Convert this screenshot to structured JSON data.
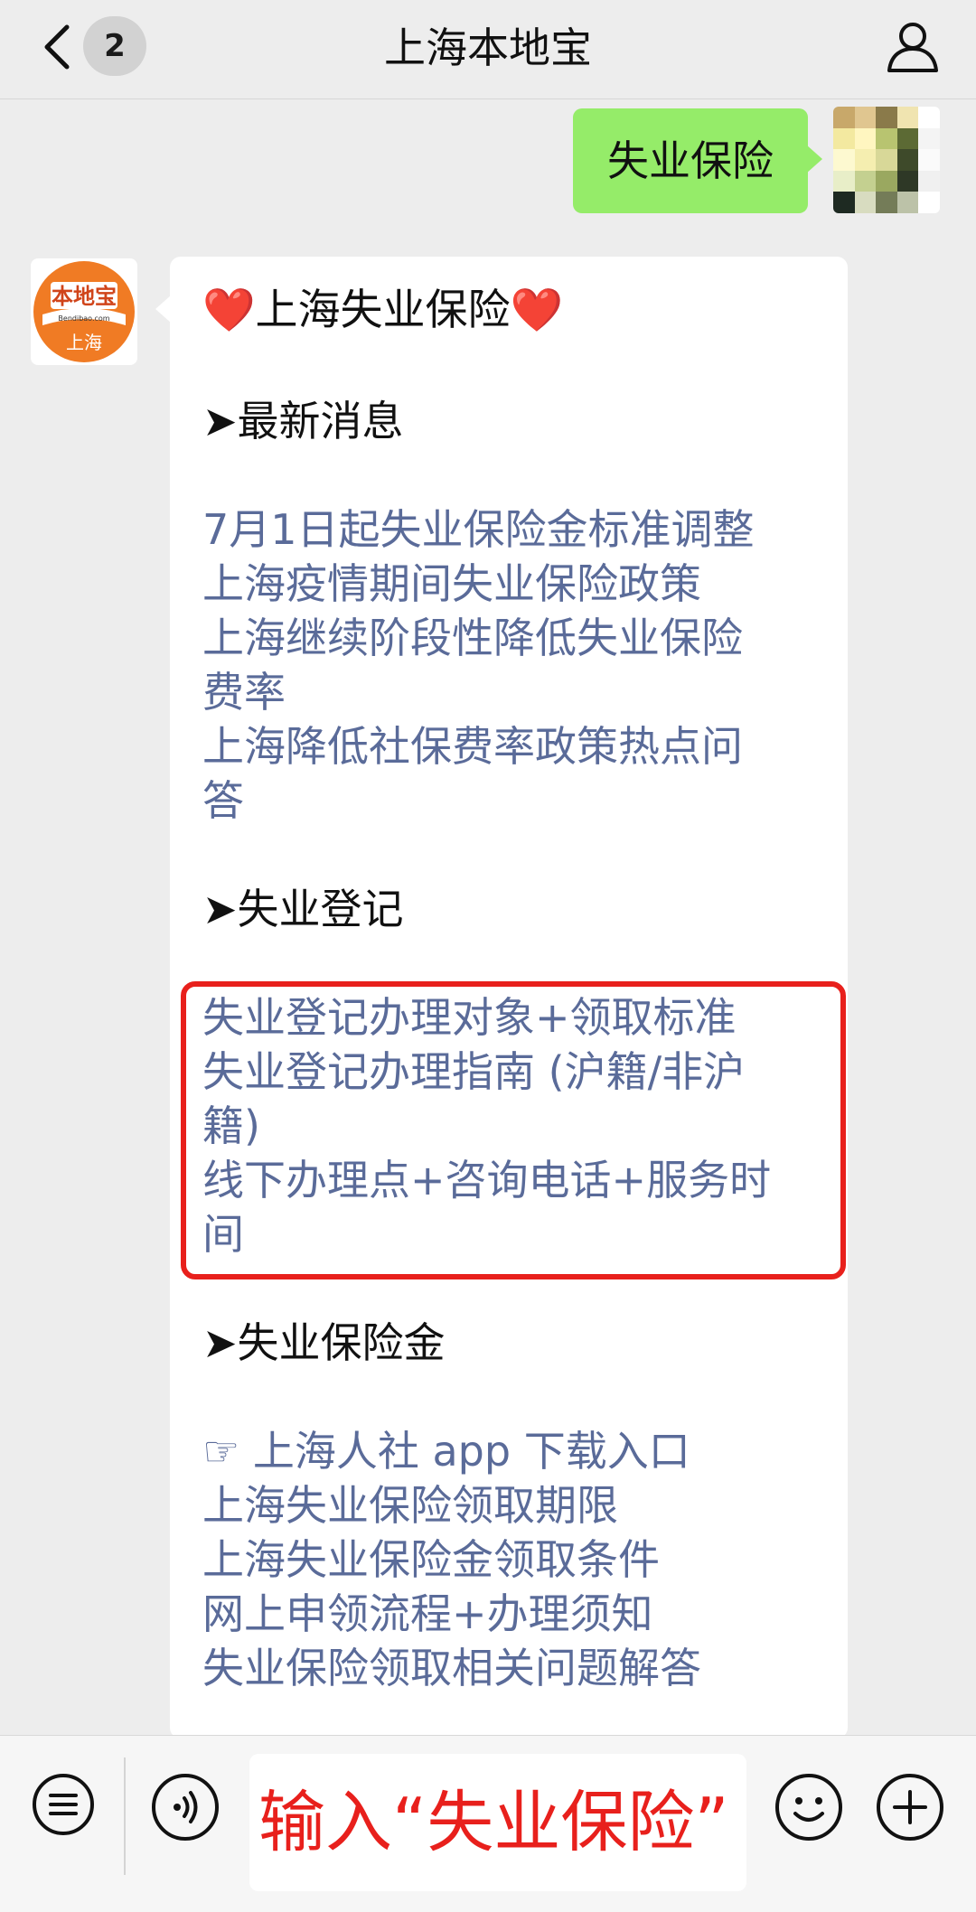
{
  "header": {
    "unread_count": "2",
    "title": "上海本地宝"
  },
  "outgoing": {
    "text": "失业保险"
  },
  "bot_avatar": {
    "logo_text": "本地宝",
    "logo_domain": "Bendibao.com",
    "city": "上海"
  },
  "message": {
    "title_heart_left": "❤️",
    "title_text": "上海失业保险",
    "title_heart_right": "❤️",
    "sections": [
      {
        "heading": "➤最新消息",
        "lines": [
          "7月1日起失业保险金标准调整",
          "上海疫情期间失业保险政策",
          "上海继续阶段性降低失业保险",
          "费率",
          "上海降低社保费率政策热点问",
          "答"
        ]
      },
      {
        "heading": "➤失业登记",
        "lines": [
          "失业登记办理对象+领取标准",
          "失业登记办理指南 (沪籍/非沪",
          "籍)",
          "线下办理点+咨询电话+服务时",
          "间"
        ]
      },
      {
        "heading": "➤失业保险金",
        "lines": [
          "☞ 上海人社 app 下载入口",
          "上海失业保险领取期限",
          "上海失业保险金领取条件",
          "网上申领流程+办理须知",
          "失业保险领取相关问题解答"
        ]
      }
    ]
  },
  "input": {
    "placeholder": "输入“失业保险”"
  },
  "colors": {
    "accent_green": "#95ec69",
    "link": "#5a6b99",
    "highlight_red": "#e8201c"
  }
}
